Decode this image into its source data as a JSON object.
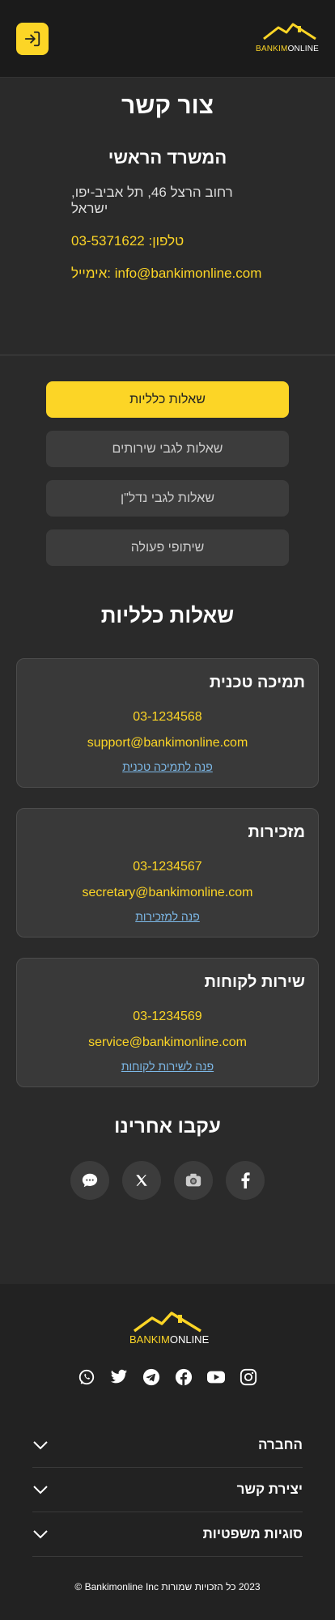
{
  "header": {
    "login_icon": "login-arrow-icon",
    "logo": {
      "yellow": "BANKIM",
      "white": "ONLINE"
    }
  },
  "contact": {
    "title": "צור קשר",
    "office": {
      "title": "המשרד הראשי",
      "address": "רחוב הרצל 46, תל אביב-יפו, ישראל",
      "phone": "טלפון: 03-5371622",
      "email": "info@bankimonline.com :אימייל"
    }
  },
  "tabs": [
    {
      "label": "שאלות כלליות",
      "active": true
    },
    {
      "label": "שאלות לגבי שירותים",
      "active": false
    },
    {
      "label": "שאלות לגבי נדל\"ן",
      "active": false
    },
    {
      "label": "שיתופי פעולה",
      "active": false
    }
  ],
  "section": {
    "title": "שאלות כלליות"
  },
  "cards": [
    {
      "title": "תמיכה טכנית",
      "phone": "03-1234568",
      "email": "support@bankimonline.com",
      "link": "פנה לתמיכה טכנית"
    },
    {
      "title": "מזכירות",
      "phone": "03-1234567",
      "email": "secretary@bankimonline.com",
      "link": "פנה למזכירות"
    },
    {
      "title": "שירות לקוחות",
      "phone": "03-1234569",
      "email": "service@bankimonline.com",
      "link": "פנה לשירות לקוחות"
    }
  ],
  "follow": {
    "title": "עקבו אחרינו",
    "icons": [
      "chat-icon",
      "x-icon",
      "camera-icon",
      "facebook-icon"
    ]
  },
  "footer": {
    "logo": {
      "yellow": "BANKIM",
      "white": "ONLINE"
    },
    "icons": [
      "whatsapp-icon",
      "twitter-icon",
      "telegram-icon",
      "facebook-icon",
      "youtube-icon",
      "instagram-icon"
    ],
    "accordion": [
      "החברה",
      "יצירת קשר",
      "סוגיות משפטיות"
    ],
    "copyright": "2023 כל הזכויות שמורות Bankimonline Inc ©"
  },
  "colors": {
    "accent": "#fcd526",
    "link": "#7db9e8",
    "background": "#2a2a2a"
  }
}
